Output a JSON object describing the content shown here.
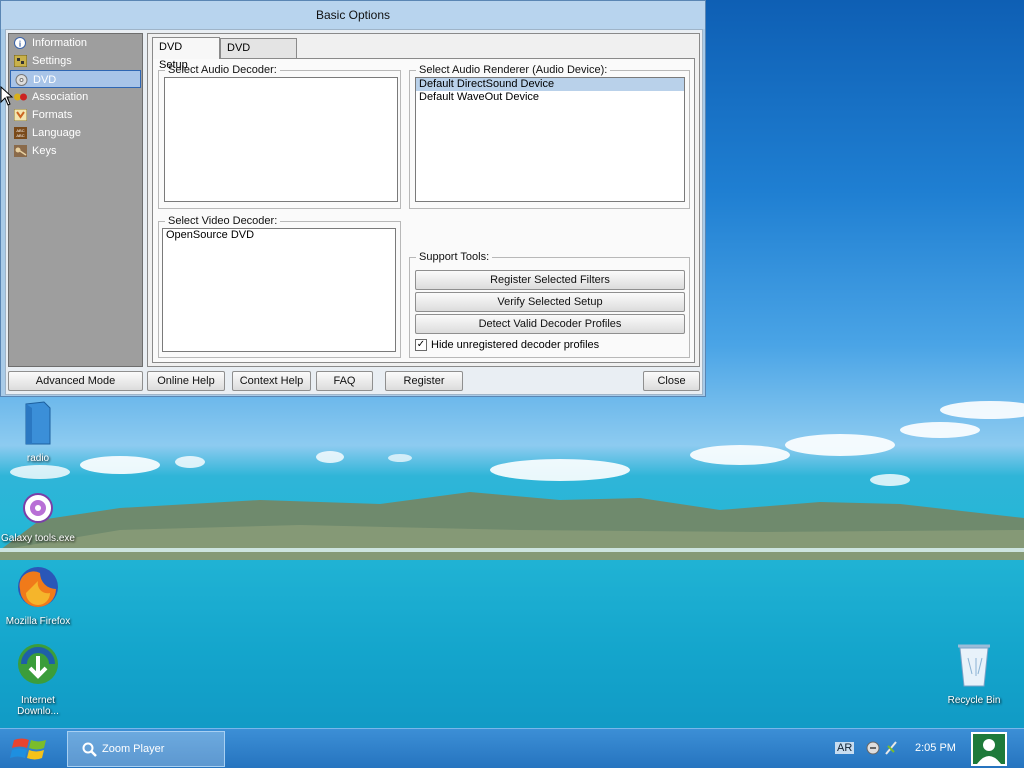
{
  "window": {
    "title": "Basic Options",
    "sidebar": {
      "items": [
        {
          "label": "Information",
          "icon": "info-icon"
        },
        {
          "label": "Settings",
          "icon": "settings-icon"
        },
        {
          "label": "DVD",
          "icon": "dvd-icon",
          "selected": true
        },
        {
          "label": "Association",
          "icon": "association-icon"
        },
        {
          "label": "Formats",
          "icon": "formats-icon"
        },
        {
          "label": "Language",
          "icon": "language-icon"
        },
        {
          "label": "Keys",
          "icon": "keys-icon"
        }
      ]
    },
    "tabs": [
      {
        "label": "DVD Setup",
        "active": true
      },
      {
        "label": "DVD Settings",
        "active": false
      }
    ],
    "audio_decoder": {
      "label": "Select Audio Decoder:",
      "items": []
    },
    "audio_renderer": {
      "label": "Select Audio Renderer (Audio Device):",
      "items": [
        "Default DirectSound Device",
        "Default WaveOut Device"
      ],
      "selected_index": 0
    },
    "video_decoder": {
      "label": "Select Video Decoder:",
      "items": [
        "OpenSource DVD"
      ]
    },
    "support_tools": {
      "label": "Support Tools:",
      "register_filters": "Register Selected Filters",
      "verify_setup": "Verify Selected Setup",
      "detect_profiles": "Detect Valid Decoder Profiles",
      "hide_unregistered": {
        "label": "Hide unregistered decoder profiles",
        "checked": true
      }
    },
    "bottom_buttons": {
      "advanced_mode": "Advanced Mode",
      "online_help": "Online Help",
      "context_help": "Context Help",
      "faq": "FAQ",
      "register": "Register",
      "close": "Close"
    }
  },
  "desktop_icons": [
    {
      "label": "radio",
      "icon": "folder-icon"
    },
    {
      "label": "Galaxy tools.exe",
      "icon": "galaxy-icon"
    },
    {
      "label": "Mozilla Firefox",
      "icon": "firefox-icon"
    },
    {
      "label": "Internet Downlo...",
      "icon": "idm-icon"
    },
    {
      "label": "Recycle Bin",
      "icon": "recycle-bin-icon"
    }
  ],
  "taskbar": {
    "items": [
      {
        "label": "Zoom Player",
        "icon": "zoom-player-icon"
      }
    ],
    "language": "AR",
    "clock": "2:05 PM"
  },
  "colors": {
    "selection": "#b9d1ea",
    "sidebar_bg": "#9e9e9e",
    "taskbar": "#2674bf"
  }
}
